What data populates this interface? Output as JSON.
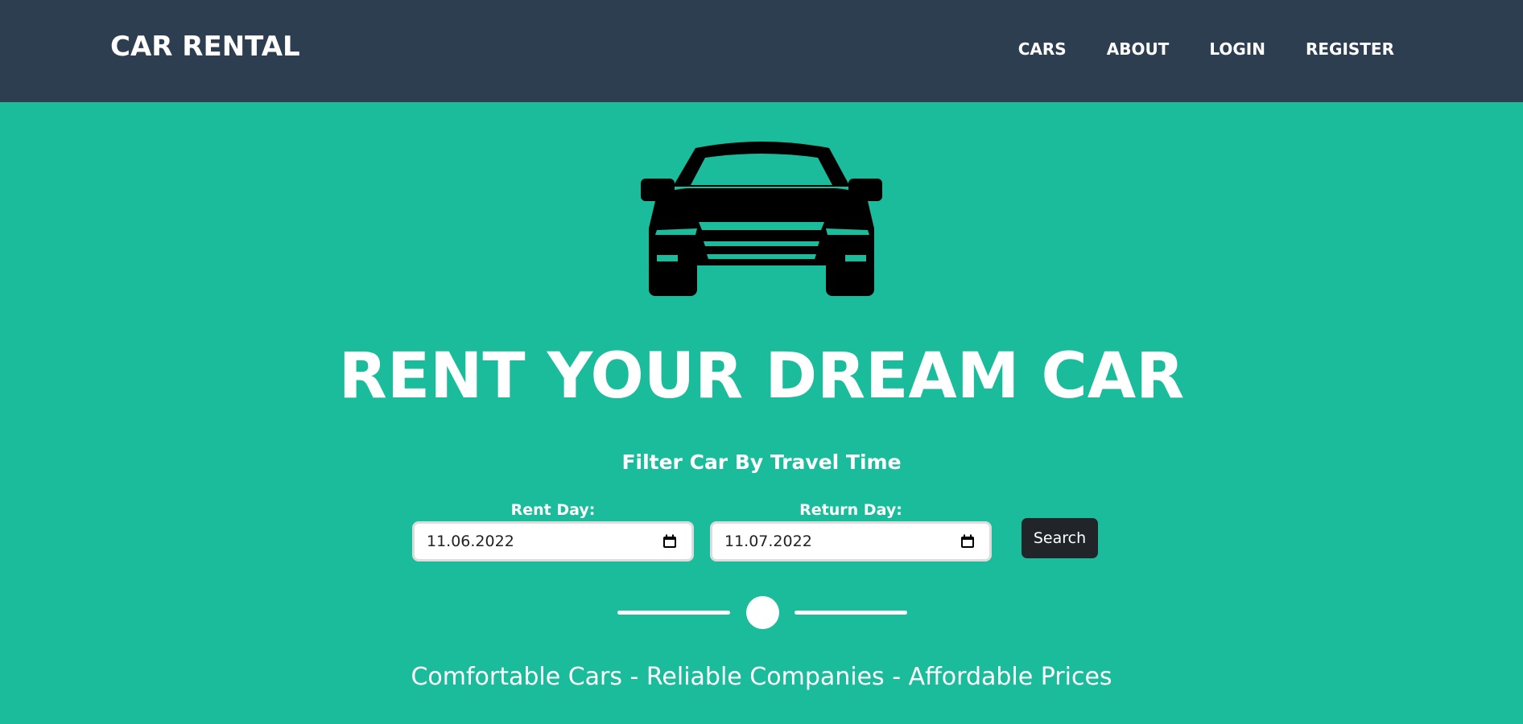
{
  "navbar": {
    "brand": "CAR RENTAL",
    "links": [
      "CARS",
      "ABOUT",
      "LOGIN",
      "REGISTER"
    ],
    "background": "#2c3e50"
  },
  "hero": {
    "background": "#1abc9c",
    "icon": "car-front-icon",
    "title": "RENT YOUR DREAM CAR",
    "filter_heading": "Filter Car By Travel Time",
    "rent_day": {
      "label": "Rent Day:",
      "value": "11.06.2022",
      "icon": "calendar-icon"
    },
    "return_day": {
      "label": "Return Day:",
      "value": "11.07.2022",
      "icon": "calendar-icon"
    },
    "search_label": "Search",
    "tagline": "Comfortable Cars - Reliable Companies - Affordable Prices"
  }
}
